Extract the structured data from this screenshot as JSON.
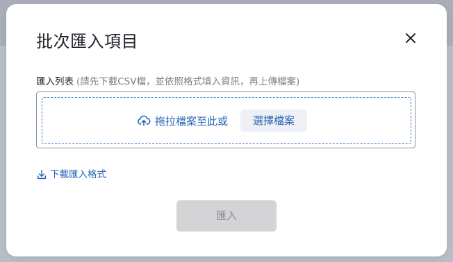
{
  "modal": {
    "title": "批次匯入項目",
    "close_icon": "close-icon"
  },
  "field": {
    "label": "匯入列表",
    "hint": "(請先下載CSV檔，並依照格式填入資訊，再上傳檔案)"
  },
  "upload": {
    "icon": "cloud-upload-icon",
    "drop_text": "拖拉檔案至此或",
    "choose_label": "選擇檔案"
  },
  "download": {
    "icon": "download-icon",
    "label": "下載匯入格式"
  },
  "actions": {
    "import_label": "匯入",
    "import_disabled": true
  },
  "colors": {
    "accent": "#2563b5",
    "dashed_border": "#3a78c3",
    "disabled_bg": "#d4d4d6",
    "disabled_text": "#8a8c90"
  }
}
